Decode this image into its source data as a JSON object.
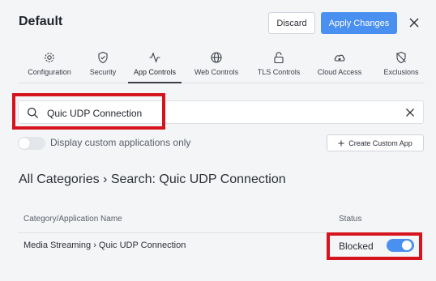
{
  "header": {
    "title": "Default",
    "discard_label": "Discard",
    "apply_label": "Apply Changes"
  },
  "tabs": [
    {
      "label": "Configuration",
      "icon": "gear-icon"
    },
    {
      "label": "Security",
      "icon": "shield-check-icon"
    },
    {
      "label": "App Controls",
      "icon": "activity-icon",
      "active": true
    },
    {
      "label": "Web Controls",
      "icon": "globe-icon"
    },
    {
      "label": "TLS Controls",
      "icon": "lock-icon"
    },
    {
      "label": "Cloud Access",
      "icon": "cloud-lock-icon"
    },
    {
      "label": "Exclusions",
      "icon": "shield-off-icon"
    }
  ],
  "search": {
    "value": "Quic UDP Connection",
    "placeholder": ""
  },
  "filter": {
    "custom_only_label": "Display custom applications only",
    "custom_only_enabled": false
  },
  "create_button": {
    "label": "Create Custom App"
  },
  "heading": "All Categories › Search: Quic UDP Connection",
  "table": {
    "columns": [
      "Category/Application Name",
      "Status"
    ],
    "rows": [
      {
        "name": "Media Streaming › Quic UDP Connection",
        "status": "Blocked",
        "enabled": true
      }
    ]
  },
  "colors": {
    "accent": "#4a90f0",
    "highlight": "#d5141d"
  }
}
